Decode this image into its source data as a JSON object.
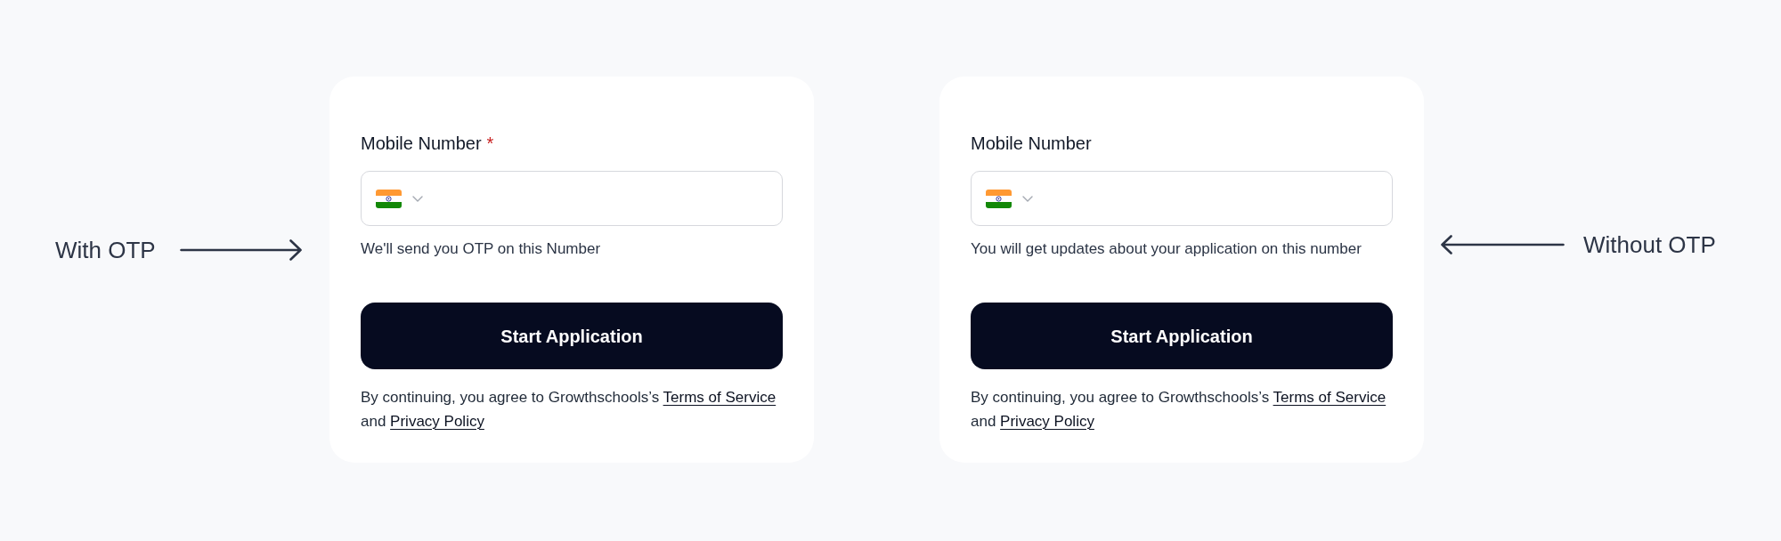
{
  "left_note": {
    "text": "With OTP"
  },
  "cards": [
    {
      "label": "Mobile Number",
      "required_mark": "*",
      "hint": "We'll send you OTP on this Number",
      "button": "Start Application",
      "consent": [
        {
          "kind": "text",
          "text": "By continuing, you agree to Growthschools’s"
        },
        {
          "kind": "link",
          "text": "Terms of Service"
        },
        {
          "kind": "text",
          "text": "and"
        },
        {
          "kind": "link",
          "text": "Privacy Policy"
        }
      ]
    },
    {
      "label": "Mobile Number",
      "hint": "You will get updates about your application on this number",
      "button": "Start Application",
      "consent": [
        {
          "kind": "text",
          "text": "By continuing, you agree to Growthschools’s"
        },
        {
          "kind": "link",
          "text": "Terms of Service"
        },
        {
          "kind": "text",
          "text": "and"
        },
        {
          "kind": "link",
          "text": "Privacy Policy"
        }
      ]
    }
  ],
  "right_note": {
    "text": "Without OTP"
  }
}
